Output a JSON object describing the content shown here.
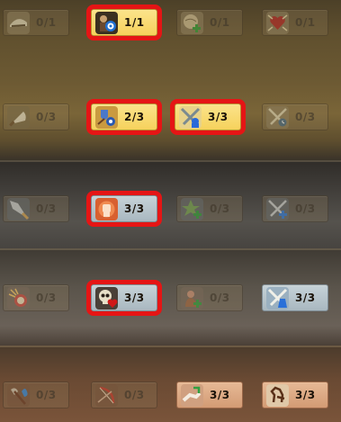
{
  "rows": [
    {
      "tiles": [
        {
          "name": "helmet-icon",
          "count": "0/1",
          "state": "inactive"
        },
        {
          "name": "archer-target-icon",
          "count": "1/1",
          "state": "active"
        },
        {
          "name": "globe-plus-icon",
          "count": "0/1",
          "state": "inactive"
        },
        {
          "name": "heart-burst-icon",
          "count": "0/1",
          "state": "inactive"
        }
      ]
    },
    {
      "tiles": [
        {
          "name": "blade-slash-icon",
          "count": "0/3",
          "state": "inactive"
        },
        {
          "name": "shield-gear-icon",
          "count": "2/3",
          "state": "active"
        },
        {
          "name": "crossed-swords-unit-icon",
          "count": "3/3",
          "state": "active"
        },
        {
          "name": "crossed-swords-clock-icon",
          "count": "0/3",
          "state": "inactive"
        }
      ]
    },
    {
      "tiles": [
        {
          "name": "spear-icon",
          "count": "0/3",
          "state": "inactive"
        },
        {
          "name": "raised-fist-icon",
          "count": "3/3",
          "state": "active"
        },
        {
          "name": "star-plus-icon",
          "count": "0/3",
          "state": "inactive"
        },
        {
          "name": "crossed-swords-plus-icon",
          "count": "0/3",
          "state": "inactive"
        }
      ]
    },
    {
      "tiles": [
        {
          "name": "target-rays-icon",
          "count": "0/3",
          "state": "inactive"
        },
        {
          "name": "skull-heart-icon",
          "count": "3/3",
          "state": "active"
        },
        {
          "name": "money-bag-plus-icon",
          "count": "0/3",
          "state": "inactive"
        },
        {
          "name": "crossed-swords-potion-icon",
          "count": "3/3",
          "state": "active"
        }
      ]
    },
    {
      "tiles": [
        {
          "name": "axe-flame-icon",
          "count": "0/3",
          "state": "inactive"
        },
        {
          "name": "bow-arrow-icon",
          "count": "0/3",
          "state": "inactive"
        },
        {
          "name": "healing-hand-icon",
          "count": "3/3",
          "state": "active"
        },
        {
          "name": "rearing-horse-icon",
          "count": "3/3",
          "state": "active"
        }
      ]
    }
  ],
  "colors": {
    "highlight_red": "#e51515",
    "active_gold": "#f6d25c",
    "active_silver": "#a9b8c0",
    "active_peach": "#d39b74"
  }
}
